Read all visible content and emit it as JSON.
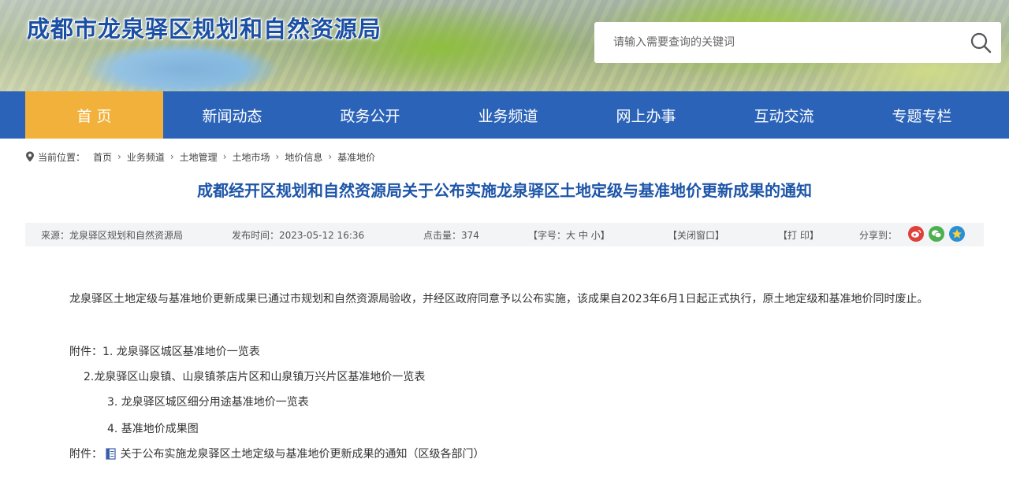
{
  "header": {
    "site_title": "成都市龙泉驿区规划和自然资源局",
    "search_placeholder": "请输入需要查询的关键词"
  },
  "nav": {
    "items": [
      {
        "label": "首 页"
      },
      {
        "label": "新闻动态"
      },
      {
        "label": "政务公开"
      },
      {
        "label": "业务频道"
      },
      {
        "label": "网上办事"
      },
      {
        "label": "互动交流"
      },
      {
        "label": "专题专栏"
      }
    ]
  },
  "breadcrumb": {
    "label": "当前位置：",
    "items": [
      "首页",
      "业务频道",
      "土地管理",
      "土地市场",
      "地价信息",
      "基准地价"
    ]
  },
  "article": {
    "title": "成都经开区规划和自然资源局关于公布实施龙泉驿区土地定级与基准地价更新成果的通知",
    "meta": {
      "source": "来源：龙泉驿区规划和自然资源局",
      "publish_time": "发布时间：2023-05-12 16:36",
      "clicks": "点击量：374",
      "font_size": "【字号：大 中 小】",
      "close_window": "【关闭窗口】",
      "print": "【打 印】",
      "share": "分享到："
    },
    "paragraph": "龙泉驿区土地定级与基准地价更新成果已通过市规划和自然资源局验收，并经区政府同意予以公布实施，该成果自2023年6月1日起正式执行，原土地定级和基准地价同时废止。",
    "attachments_list": [
      "附件：1. 龙泉驿区城区基准地价一览表",
      "2.龙泉驿区山泉镇、山泉镇茶店片区和山泉镇万兴片区基准地价一览表",
      "3. 龙泉驿区城区细分用途基准地价一览表",
      "4. 基准地价成果图"
    ],
    "attachment_label": "附件：",
    "attachment_file": "关于公布实施龙泉驿区土地定级与基准地价更新成果的通知（区级各部门）"
  },
  "colors": {
    "nav_bg": "#2b63b8",
    "nav_active": "#f2b13a",
    "title_blue": "#1d55a8",
    "weibo": "#e0403a",
    "wechat": "#4caf50",
    "qzone": "#2b8fd6"
  }
}
